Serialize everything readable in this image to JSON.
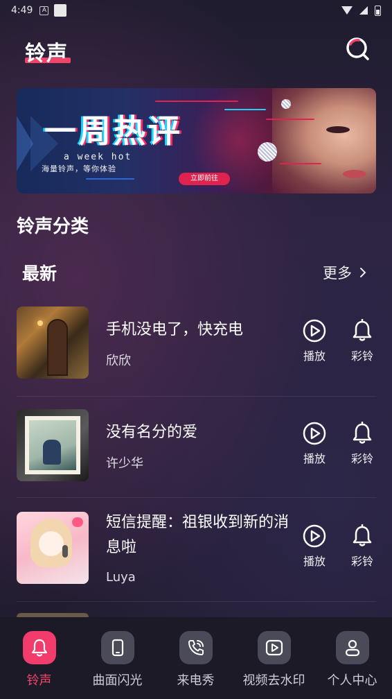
{
  "status_bar": {
    "time": "4:49",
    "notif_letter": "A"
  },
  "header": {
    "title": "铃声"
  },
  "banner": {
    "headline": "一周热评",
    "subtitle_en": "a week hot",
    "subtitle_cn": "海量铃声，等你体验",
    "cta": "立即前往"
  },
  "section": {
    "title": "铃声分类"
  },
  "latest": {
    "title": "最新",
    "more": "更多"
  },
  "songs": [
    {
      "title": "手机没电了，快充电",
      "artist": "欣欣",
      "play_label": "播放",
      "ring_label": "彩铃"
    },
    {
      "title": "没有名分的爱",
      "artist": "许少华",
      "play_label": "播放",
      "ring_label": "彩铃"
    },
    {
      "title": "短信提醒：祖银收到新的消息啦",
      "artist": "Luya",
      "play_label": "播放",
      "ring_label": "彩铃"
    }
  ],
  "nav": [
    {
      "label": "铃声",
      "icon": "bell-icon",
      "active": true
    },
    {
      "label": "曲面闪光",
      "icon": "phone-icon",
      "active": false
    },
    {
      "label": "来电秀",
      "icon": "phone-call-icon",
      "active": false
    },
    {
      "label": "视频去水印",
      "icon": "video-play-icon",
      "active": false
    },
    {
      "label": "个人中心",
      "icon": "user-icon",
      "active": false
    }
  ],
  "colors": {
    "accent": "#f2436a",
    "nav_bg": "#1c1a26",
    "icon_bg": "#4a4a58"
  }
}
